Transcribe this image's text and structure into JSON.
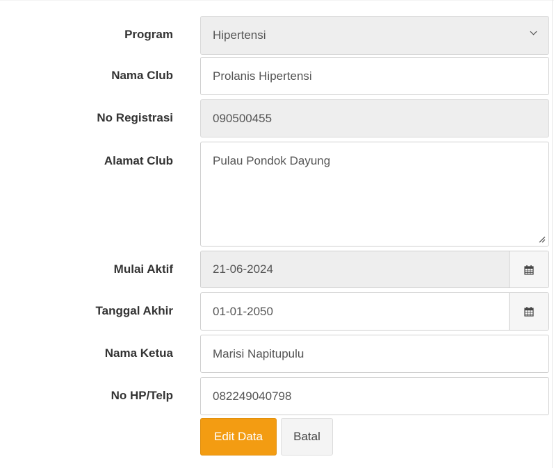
{
  "form": {
    "program": {
      "label": "Program",
      "value": "Hipertensi"
    },
    "nama_club": {
      "label": "Nama Club",
      "value": "Prolanis Hipertensi"
    },
    "no_registrasi": {
      "label": "No Registrasi",
      "value": "090500455"
    },
    "alamat_club": {
      "label": "Alamat Club",
      "value": "Pulau Pondok Dayung"
    },
    "mulai_aktif": {
      "label": "Mulai Aktif",
      "value": "21-06-2024"
    },
    "tanggal_akhir": {
      "label": "Tanggal Akhir",
      "value": "01-01-2050"
    },
    "nama_ketua": {
      "label": "Nama Ketua",
      "value": "Marisi Napitupulu"
    },
    "no_hp": {
      "label": "No HP/Telp",
      "value": "082249040798"
    }
  },
  "buttons": {
    "edit": "Edit Data",
    "cancel": "Batal"
  },
  "icons": {
    "select": "chevron-down-icon",
    "date": "calendar-icon",
    "resize": "resize-grip-icon"
  },
  "colors": {
    "primary": "#f39c12",
    "readonly_bg": "#eeeeee"
  }
}
